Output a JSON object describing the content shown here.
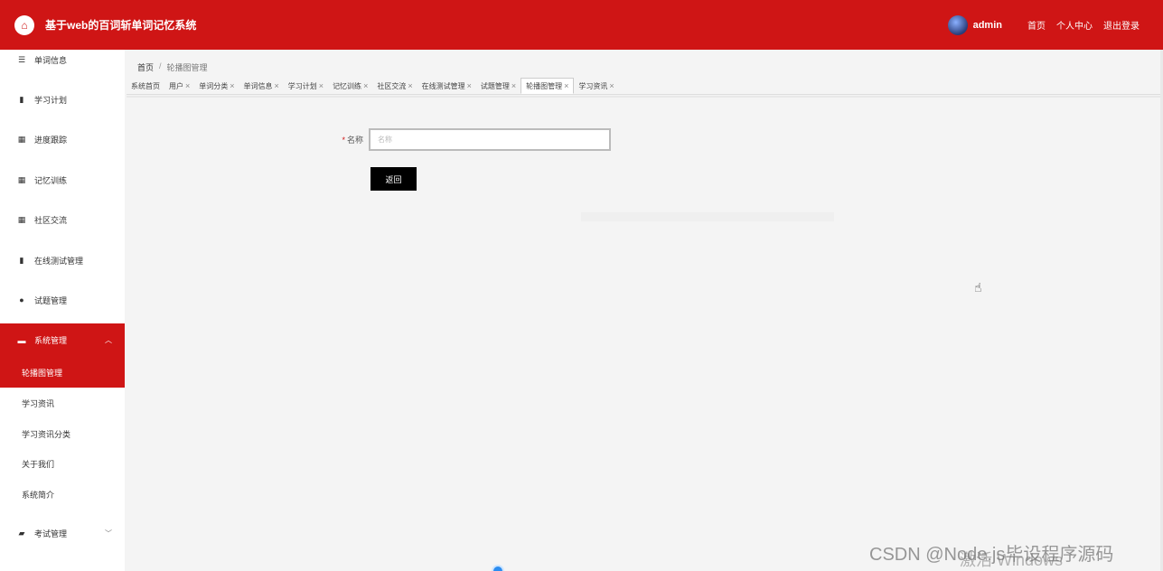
{
  "header": {
    "title": "基于web的百词斩单词记忆系统",
    "username": "admin",
    "links": [
      "首页",
      "个人中心",
      "退出登录"
    ]
  },
  "sidebar": {
    "items": [
      {
        "label": "单词信息",
        "icon": "sliders-icon"
      },
      {
        "label": "学习计划",
        "icon": "clipboard-icon"
      },
      {
        "label": "进度跟踪",
        "icon": "grid-icon"
      },
      {
        "label": "记忆训练",
        "icon": "grid-icon"
      },
      {
        "label": "社区交流",
        "icon": "grid-icon"
      },
      {
        "label": "在线测试管理",
        "icon": "clipboard-check-icon"
      },
      {
        "label": "试题管理",
        "icon": "user-icon"
      },
      {
        "label": "系统管理",
        "icon": "monitor-icon"
      },
      {
        "label": "考试管理",
        "icon": "chart-icon"
      }
    ],
    "system_sub": [
      "轮播图管理",
      "学习资讯",
      "学习资讯分类",
      "关于我们",
      "系统简介"
    ]
  },
  "breadcrumb": {
    "home": "首页",
    "separator": "/",
    "current": "轮播图管理"
  },
  "tabs": [
    {
      "label": "系统首页",
      "closable": false
    },
    {
      "label": "用户",
      "closable": true
    },
    {
      "label": "单词分类",
      "closable": true
    },
    {
      "label": "单词信息",
      "closable": true
    },
    {
      "label": "学习计划",
      "closable": true
    },
    {
      "label": "记忆训练",
      "closable": true
    },
    {
      "label": "社区交流",
      "closable": true
    },
    {
      "label": "在线测试管理",
      "closable": true
    },
    {
      "label": "试题管理",
      "closable": true
    },
    {
      "label": "轮播图管理",
      "closable": true
    },
    {
      "label": "学习资讯",
      "closable": true
    }
  ],
  "tab_close_glyph": "×",
  "form": {
    "required_mark": "*",
    "name_label": "名称",
    "name_placeholder": "名称",
    "name_value": "",
    "back_label": "返回"
  },
  "watermarks": {
    "activate": "激活 Windows",
    "csdn": "CSDN @Node.js毕设程序源码"
  },
  "colors": {
    "accent": "#cf1515"
  }
}
